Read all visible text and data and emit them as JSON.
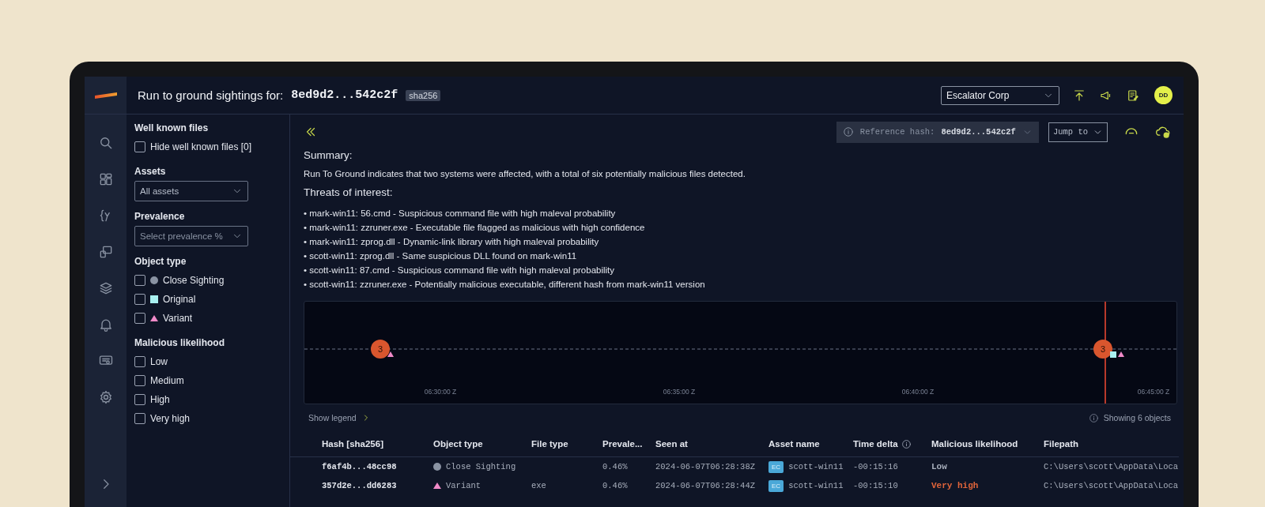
{
  "header": {
    "title": "Run to ground sightings for:",
    "hash": "8ed9d2...542c2f",
    "hash_type": "sha256",
    "organization": "Escalator Corp",
    "avatar": "DD"
  },
  "filters": {
    "sections": [
      {
        "title": "Well known files",
        "kind": "checkboxes",
        "items": [
          {
            "label": "Hide well known files [0]",
            "checked": false
          }
        ]
      },
      {
        "title": "Assets",
        "kind": "select",
        "items": [
          {
            "value": "All assets"
          }
        ]
      },
      {
        "title": "Prevalence",
        "kind": "select",
        "items": [
          {
            "placeholder": "Select prevalence %"
          }
        ]
      },
      {
        "title": "Object type",
        "kind": "checkboxes",
        "items": [
          {
            "label": "Close Sighting",
            "checked": false,
            "kind": "circle",
            "color": "#8a93a3"
          },
          {
            "label": "Original",
            "checked": false,
            "kind": "square",
            "color": "#a8f0f0"
          },
          {
            "label": "Variant",
            "checked": false,
            "kind": "triangle",
            "color": "#f08ac8"
          }
        ]
      },
      {
        "title": "Malicious likelihood",
        "kind": "checkboxes",
        "items": [
          {
            "label": "Low",
            "checked": false
          },
          {
            "label": "Medium",
            "checked": false
          },
          {
            "label": "High",
            "checked": false
          },
          {
            "label": "Very high",
            "checked": false
          }
        ]
      }
    ]
  },
  "toolbar": {
    "reference_label": "Reference hash:",
    "reference_hash": "8ed9d2...542c2f",
    "jump_to": "Jump to"
  },
  "summary": {
    "heading": "Summary:",
    "text": "Run To Ground indicates that two systems were affected, with a total of six potentially malicious files detected.",
    "threats_heading": "Threats of interest:",
    "threats": [
      "• mark-win11: 56.cmd - Suspicious command file with high maleval probability",
      "• mark-win11: zzruner.exe - Executable file flagged as malicious with high confidence",
      "• mark-win11: zprog.dll - Dynamic-link library with high maleval probability",
      "• scott-win11: zprog.dll - Same suspicious DLL found on mark-win11",
      "• scott-win11: 87.cmd - Suspicious command file with high maleval probability",
      "• scott-win11: zzruner.exe - Potentially malicious executable, different hash from mark-win11 version"
    ]
  },
  "timeline": {
    "ticks": [
      "06:30:00 Z",
      "06:35:00 Z",
      "06:40:00 Z",
      "06:45:00 Z"
    ],
    "clusters": [
      {
        "count": "3",
        "reference": false,
        "markers": [
          {
            "kind": "triangle",
            "color": "#f08ac8"
          }
        ]
      },
      {
        "count": "3",
        "reference": true,
        "markers": [
          {
            "kind": "square",
            "color": "#a8f0f0"
          },
          {
            "kind": "triangle",
            "color": "#f08ac8"
          }
        ]
      }
    ]
  },
  "show_legend": "Show legend",
  "object_count": "Showing 6 objects",
  "table": {
    "columns": [
      "Hash [sha256]",
      "Object type",
      "File type",
      "Prevale...",
      "Seen at",
      "Asset name",
      "Time delta",
      "Malicious likelihood",
      "Filepath"
    ],
    "rows": [
      {
        "hash": "f6af4b...48cc98",
        "object_type": {
          "text": "Close Sighting",
          "kind": "circle",
          "color": "#8a93a3"
        },
        "prevalence": "0.46%",
        "seen_at": "2024-06-07T06:28:38Z",
        "asset_badge": "EC",
        "asset": "scott-win11",
        "time_delta": "-00:15:16",
        "likelihood": {
          "text": "Low",
          "color": "#a8afbc"
        },
        "filepath": "C:\\Users\\scott\\AppData\\Loca"
      },
      {
        "hash": "357d2e...dd6283",
        "object_type": {
          "text": "Variant",
          "kind": "triangle",
          "color": "#f08ac8"
        },
        "file_type": "exe",
        "prevalence": "0.46%",
        "seen_at": "2024-06-07T06:28:44Z",
        "asset_badge": "EC",
        "asset": "scott-win11",
        "time_delta": "-00:15:10",
        "likelihood": {
          "text": "Very high",
          "color": "#e0643a"
        },
        "filepath": "C:\\Users\\scott\\AppData\\Loca"
      }
    ]
  }
}
